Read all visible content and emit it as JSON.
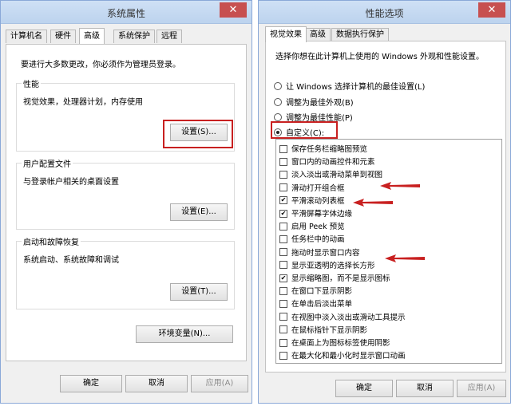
{
  "left_window": {
    "title": "系统属性",
    "close_glyph": "✕",
    "tabs": [
      "计算机名",
      "硬件",
      "高级",
      "系统保护",
      "远程"
    ],
    "active_tab": 2,
    "admin_notice": "要进行大多数更改，你必须作为管理员登录。",
    "performance": {
      "title": "性能",
      "desc": "视觉效果，处理器计划，内存使用",
      "button": "设置(S)..."
    },
    "user_profiles": {
      "title": "用户配置文件",
      "desc": "与登录帐户相关的桌面设置",
      "button": "设置(E)..."
    },
    "startup": {
      "title": "启动和故障恢复",
      "desc": "系统启动、系统故障和调试",
      "button": "设置(T)..."
    },
    "env_button": "环境变量(N)...",
    "ok": "确定",
    "cancel": "取消",
    "apply": "应用(A)"
  },
  "right_window": {
    "title": "性能选项",
    "close_glyph": "✕",
    "tabs": [
      "视觉效果",
      "高级",
      "数据执行保护"
    ],
    "active_tab": 0,
    "intro": "选择你想在此计算机上使用的 Windows 外观和性能设置。",
    "radios": [
      {
        "label": "让 Windows 选择计算机的最佳设置(L)",
        "selected": false
      },
      {
        "label": "调整为最佳外观(B)",
        "selected": false
      },
      {
        "label": "调整为最佳性能(P)",
        "selected": false
      },
      {
        "label": "自定义(C):",
        "selected": true
      }
    ],
    "checkboxes": [
      {
        "label": "保存任务栏缩略图预览",
        "checked": false
      },
      {
        "label": "窗口内的动画控件和元素",
        "checked": false
      },
      {
        "label": "淡入淡出或滑动菜单到视图",
        "checked": false
      },
      {
        "label": "滑动打开组合框",
        "checked": false
      },
      {
        "label": "平滑滚动列表框",
        "checked": true
      },
      {
        "label": "平滑屏幕字体边缘",
        "checked": true
      },
      {
        "label": "启用 Peek 预览",
        "checked": false
      },
      {
        "label": "任务栏中的动画",
        "checked": false
      },
      {
        "label": "拖动时显示窗口内容",
        "checked": false
      },
      {
        "label": "显示亚透明的选择长方形",
        "checked": false
      },
      {
        "label": "显示缩略图，而不是显示图标",
        "checked": true
      },
      {
        "label": "在窗口下显示阴影",
        "checked": false
      },
      {
        "label": "在单击后淡出菜单",
        "checked": false
      },
      {
        "label": "在视图中淡入淡出或滑动工具提示",
        "checked": false
      },
      {
        "label": "在鼠标指针下显示阴影",
        "checked": false
      },
      {
        "label": "在桌面上为图标标签使用阴影",
        "checked": false
      },
      {
        "label": "在最大化和最小化时显示窗口动画",
        "checked": false
      }
    ],
    "check_glyph": "✔",
    "ok": "确定",
    "cancel": "取消",
    "apply": "应用(A)"
  },
  "colors": {
    "highlight_red": "#c82020",
    "titlebar_blue": "#c4d8f1",
    "close_red": "#c75050"
  }
}
